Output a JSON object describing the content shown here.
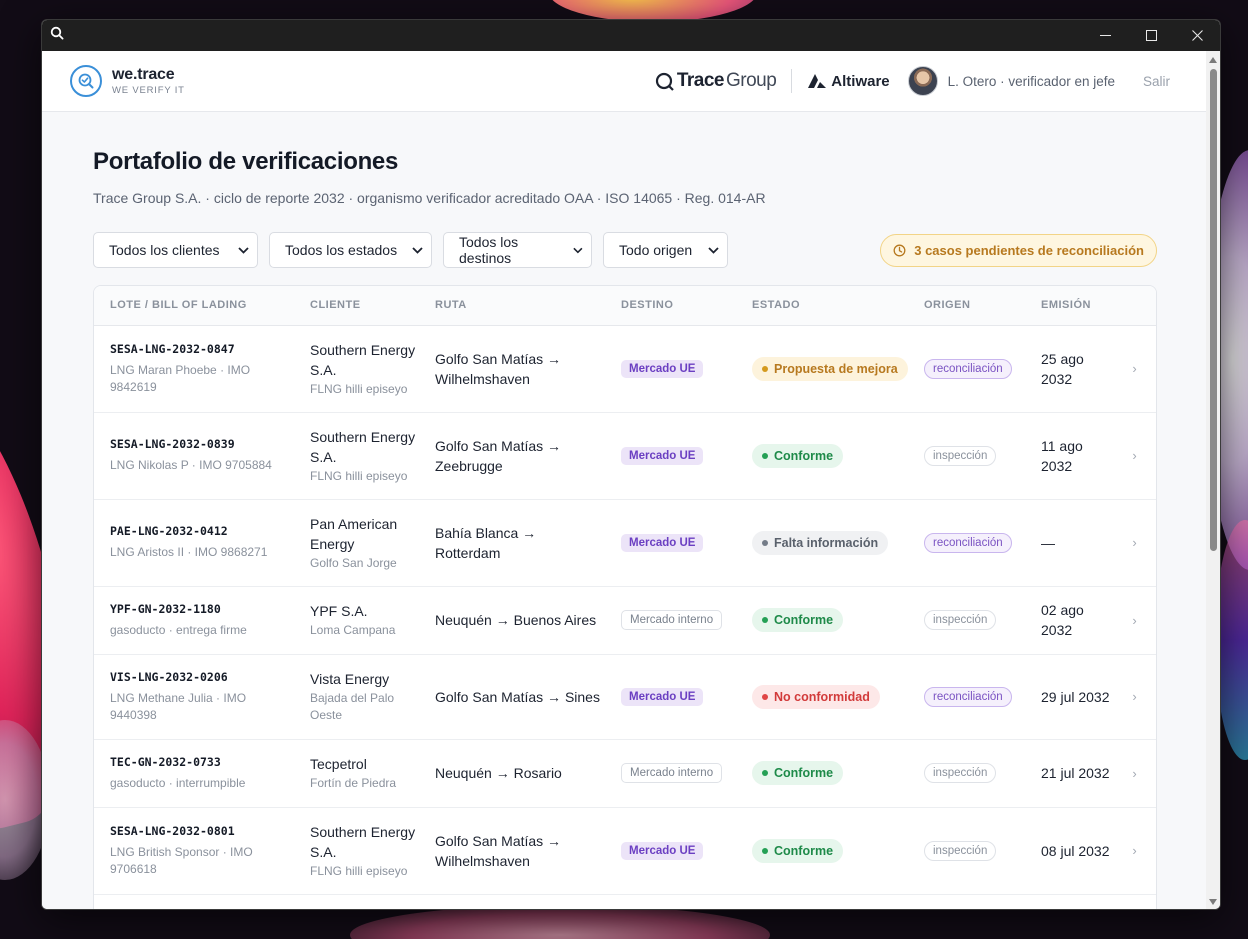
{
  "window": {
    "controls": {
      "search_icon": "search-icon",
      "minimize_icon": "minimize-icon",
      "maximize_icon": "maximize-icon",
      "close_icon": "close-icon"
    }
  },
  "header": {
    "brand_name": "we.trace",
    "brand_tagline": "WE VERIFY IT",
    "partner1": {
      "bold": "Trace",
      "regular": "Group"
    },
    "partner2": "Altiware",
    "user": "L. Otero · verificador en jefe",
    "logout": "Salir"
  },
  "page": {
    "title": "Portafolio de verificaciones",
    "subtitle": "Trace Group S.A. · ciclo de reporte 2032 · organismo verificador acreditado OAA · ISO 14065 · Reg. 014-AR"
  },
  "filters": [
    {
      "value": "Todos los clientes"
    },
    {
      "value": "Todos los estados"
    },
    {
      "value": "Todos los destinos"
    },
    {
      "value": "Todo origen"
    }
  ],
  "pending_badge": "3 casos pendientes de reconciliación",
  "table": {
    "headers": [
      "LOTE / BILL OF LADING",
      "CLIENTE",
      "RUTA",
      "DESTINO",
      "ESTADO",
      "ORIGEN",
      "EMISIÓN"
    ],
    "rows": [
      {
        "lote": "SESA-LNG-2032-0847",
        "vessel": "LNG Maran Phoebe · IMO 9842619",
        "cliente": "Southern Energy S.A.",
        "sitio": "FLNG hilli episeyo",
        "ruta": "Golfo San Matías → Wilhelmshaven",
        "destino": "Mercado UE",
        "estado": "Propuesta de mejora",
        "origen": "reconciliación",
        "emision": "25 ago 2032"
      },
      {
        "lote": "SESA-LNG-2032-0839",
        "vessel": "LNG Nikolas P · IMO 9705884",
        "cliente": "Southern Energy S.A.",
        "sitio": "FLNG hilli episeyo",
        "ruta": "Golfo San Matías → Zeebrugge",
        "destino": "Mercado UE",
        "estado": "Conforme",
        "origen": "inspección",
        "emision": "11 ago 2032"
      },
      {
        "lote": "PAE-LNG-2032-0412",
        "vessel": "LNG Aristos II · IMO 9868271",
        "cliente": "Pan American Energy",
        "sitio": "Golfo San Jorge",
        "ruta": "Bahía Blanca → Rotterdam",
        "destino": "Mercado UE",
        "estado": "Falta información",
        "origen": "reconciliación",
        "emision": "—"
      },
      {
        "lote": "YPF-GN-2032-1180",
        "vessel": "gasoducto · entrega firme",
        "cliente": "YPF S.A.",
        "sitio": "Loma Campana",
        "ruta": "Neuquén → Buenos Aires",
        "destino": "Mercado interno",
        "estado": "Conforme",
        "origen": "inspección",
        "emision": "02 ago 2032"
      },
      {
        "lote": "VIS-LNG-2032-0206",
        "vessel": "LNG Methane Julia · IMO 9440398",
        "cliente": "Vista Energy",
        "sitio": "Bajada del Palo Oeste",
        "ruta": "Golfo San Matías → Sines",
        "destino": "Mercado UE",
        "estado": "No conformidad",
        "origen": "reconciliación",
        "emision": "29 jul 2032"
      },
      {
        "lote": "TEC-GN-2032-0733",
        "vessel": "gasoducto · interrumpible",
        "cliente": "Tecpetrol",
        "sitio": "Fortín de Piedra",
        "ruta": "Neuquén → Rosario",
        "destino": "Mercado interno",
        "estado": "Conforme",
        "origen": "inspección",
        "emision": "21 jul 2032"
      },
      {
        "lote": "SESA-LNG-2032-0801",
        "vessel": "LNG British Sponsor · IMO 9706618",
        "cliente": "Southern Energy S.A.",
        "sitio": "FLNG hilli episeyo",
        "ruta": "Golfo San Matías → Wilhelmshaven",
        "destino": "Mercado UE",
        "estado": "Conforme",
        "origen": "inspección",
        "emision": "08 jul 2032"
      }
    ]
  },
  "colors": {
    "accent": "#3a8fd8",
    "conforme": "#1e8a49",
    "mejora": "#b7791f",
    "no_conformidad": "#d23b3b",
    "mercado_ue": "#6b3fc2"
  }
}
